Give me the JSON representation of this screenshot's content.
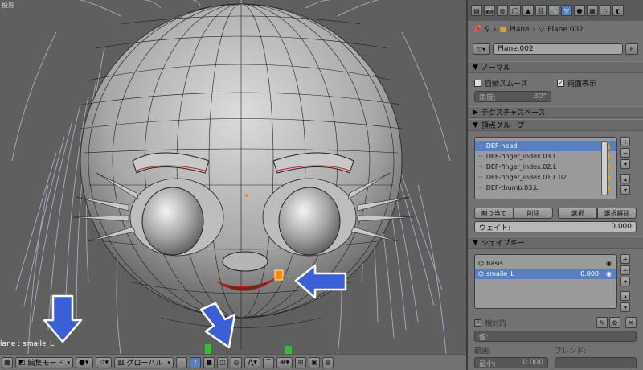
{
  "viewport": {
    "top_label": "投影",
    "object_label": "lane : smaile_L"
  },
  "header": {
    "mode": "編集モード",
    "orientation": "グローバル"
  },
  "panel": {
    "breadcrumb": {
      "object": "Plane",
      "mesh": "Plane.002"
    },
    "data_name": "Plane.002",
    "data_flag": "F",
    "normals": {
      "title": "ノーマル",
      "auto_smooth": "自動スムーズ",
      "double_sided": "両面表示",
      "angle_label": "角度:",
      "angle_value": "30°"
    },
    "texture_space": {
      "title": "テクスチャスペース"
    },
    "vertex_groups": {
      "title": "頂点グループ",
      "items": [
        "DEF-head",
        "DEF-finger_index.03.L",
        "DEF-finger_index.02.L",
        "DEF-finger_index.01.L.02",
        "DEF-thumb.03.L"
      ],
      "assign": "割り当て",
      "remove": "削除",
      "select": "選択",
      "deselect": "選択解除",
      "weight_label": "ウェイト:",
      "weight_value": "0.000"
    },
    "shape_keys": {
      "title": "シェイプキー",
      "items": [
        {
          "name": "Basis",
          "value": ""
        },
        {
          "name": "smaile_L",
          "value": "0.000"
        }
      ],
      "relative": "相対的",
      "value_label": "値:",
      "range_label": "範囲:",
      "min_label": "最小:",
      "min_value": "0.000",
      "blend_label": "ブレンド:"
    }
  },
  "colors": {
    "selection": "#5680c2",
    "arrow": "#3b5fd6",
    "vertex_highlight": "#ff8a00"
  }
}
